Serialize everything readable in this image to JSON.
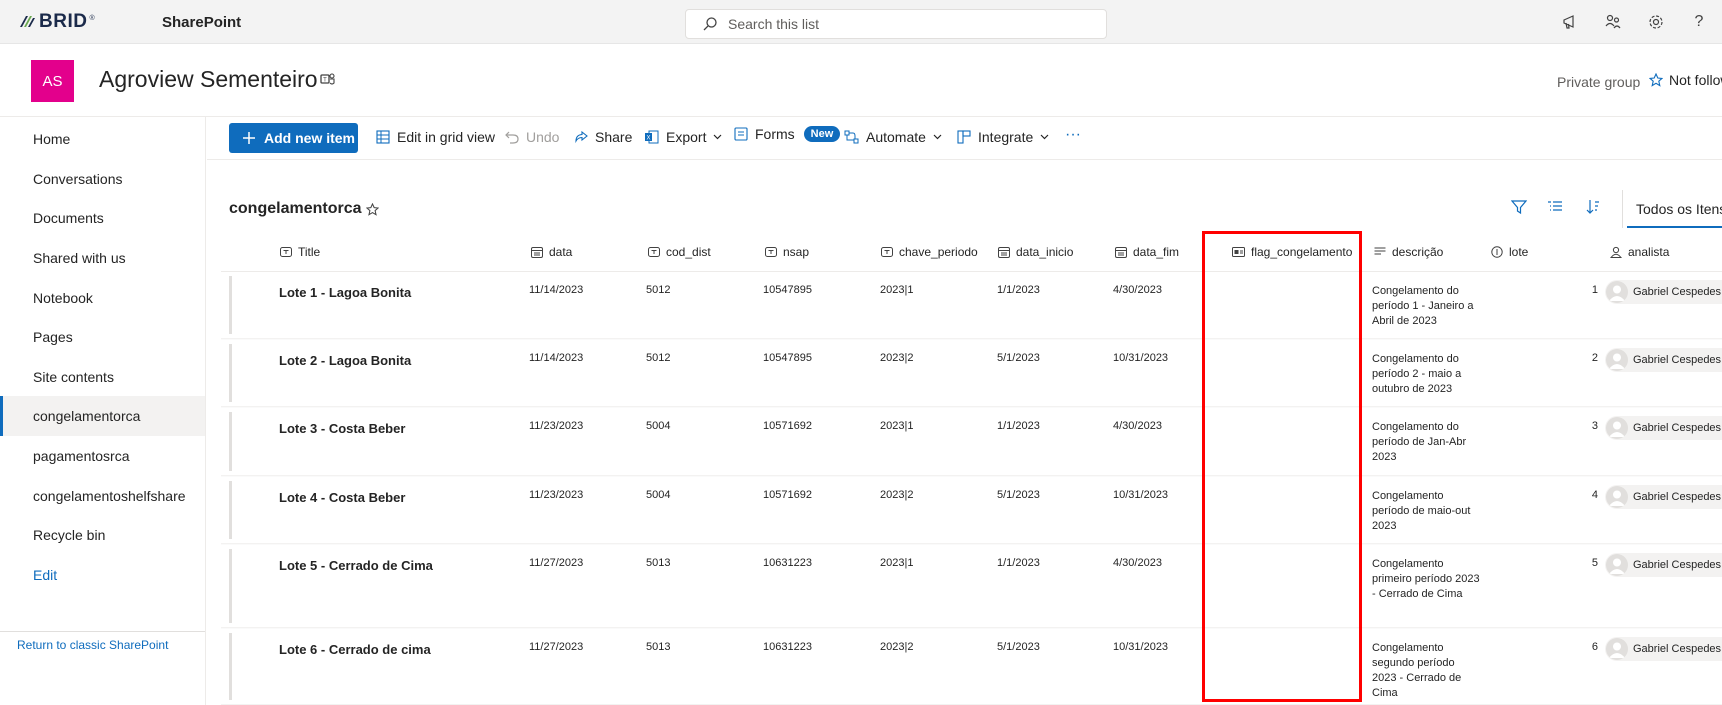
{
  "suite": {
    "brand": "BRID",
    "registered_mark": "®",
    "app_name": "SharePoint",
    "search_placeholder": "Search this list",
    "icons": [
      "megaphone-icon",
      "share-people-icon",
      "gear-icon",
      "help-icon"
    ],
    "help_label": "?"
  },
  "site": {
    "logo_initials": "AS",
    "logo_color": "#e3008c",
    "title": "Agroview Sementeiro",
    "visibility": "Private group",
    "follow_label": "Not following"
  },
  "nav": {
    "items": [
      "Home",
      "Conversations",
      "Documents",
      "Shared with us",
      "Notebook",
      "Pages",
      "Site contents",
      "congelamentorca",
      "pagamentosrca",
      "congelamentoshelfshare",
      "Recycle bin"
    ],
    "active": "congelamentorca",
    "edit_label": "Edit",
    "classic_link": "Return to classic SharePoint"
  },
  "commands": {
    "add_new": "Add new item",
    "edit_grid": "Edit in grid view",
    "undo": "Undo",
    "share": "Share",
    "export": "Export",
    "forms": "Forms",
    "forms_badge": "New",
    "automate": "Automate",
    "integrate": "Integrate",
    "more": "···"
  },
  "list": {
    "name": "congelamentorca",
    "view_name": "Todos os Itens",
    "columns": [
      "Title",
      "data",
      "cod_dist",
      "nsap",
      "chave_periodo",
      "data_inicio",
      "data_fim",
      "flag_congelamento",
      "descrição",
      "lote",
      "analista"
    ],
    "highlighted_column": "flag_congelamento",
    "highlight_color": "#ff0000",
    "rows": [
      {
        "title": "Lote 1 - Lagoa Bonita",
        "data": "11/14/2023",
        "cod_dist": "5012",
        "nsap": "10547895",
        "chave_periodo": "2023|1",
        "data_inicio": "1/1/2023",
        "data_fim": "4/30/2023",
        "flag_congelamento": "",
        "descricao": "Congelamento do período 1 - Janeiro a Abril de 2023",
        "lote": "1",
        "analista": "Gabriel Cespedes"
      },
      {
        "title": "Lote 2 - Lagoa Bonita",
        "data": "11/14/2023",
        "cod_dist": "5012",
        "nsap": "10547895",
        "chave_periodo": "2023|2",
        "data_inicio": "5/1/2023",
        "data_fim": "10/31/2023",
        "flag_congelamento": "",
        "descricao": "Congelamento do período 2 - maio a outubro de 2023",
        "lote": "2",
        "analista": "Gabriel Cespedes"
      },
      {
        "title": "Lote 3 - Costa Beber",
        "data": "11/23/2023",
        "cod_dist": "5004",
        "nsap": "10571692",
        "chave_periodo": "2023|1",
        "data_inicio": "1/1/2023",
        "data_fim": "4/30/2023",
        "flag_congelamento": "",
        "descricao": "Congelamento do período de Jan-Abr 2023",
        "lote": "3",
        "analista": "Gabriel Cespedes"
      },
      {
        "title": "Lote 4 - Costa Beber",
        "data": "11/23/2023",
        "cod_dist": "5004",
        "nsap": "10571692",
        "chave_periodo": "2023|2",
        "data_inicio": "5/1/2023",
        "data_fim": "10/31/2023",
        "flag_congelamento": "",
        "descricao": "Congelamento período de maio-out 2023",
        "lote": "4",
        "analista": "Gabriel Cespedes"
      },
      {
        "title": "Lote 5 - Cerrado de Cima",
        "data": "11/27/2023",
        "cod_dist": "5013",
        "nsap": "10631223",
        "chave_periodo": "2023|1",
        "data_inicio": "1/1/2023",
        "data_fim": "4/30/2023",
        "flag_congelamento": "",
        "descricao": "Congelamento primeiro período 2023 - Cerrado de Cima",
        "lote": "5",
        "analista": "Gabriel Cespedes"
      },
      {
        "title": "Lote 6 - Cerrado de cima",
        "data": "11/27/2023",
        "cod_dist": "5013",
        "nsap": "10631223",
        "chave_periodo": "2023|2",
        "data_inicio": "5/1/2023",
        "data_fim": "10/31/2023",
        "flag_congelamento": "",
        "descricao": "Congelamento segundo período 2023 - Cerrado de Cima",
        "lote": "6",
        "analista": "Gabriel Cespedes"
      }
    ]
  },
  "colors": {
    "accent": "#0f6cbd",
    "site_logo": "#e3008c",
    "highlight": "#ff0000"
  }
}
